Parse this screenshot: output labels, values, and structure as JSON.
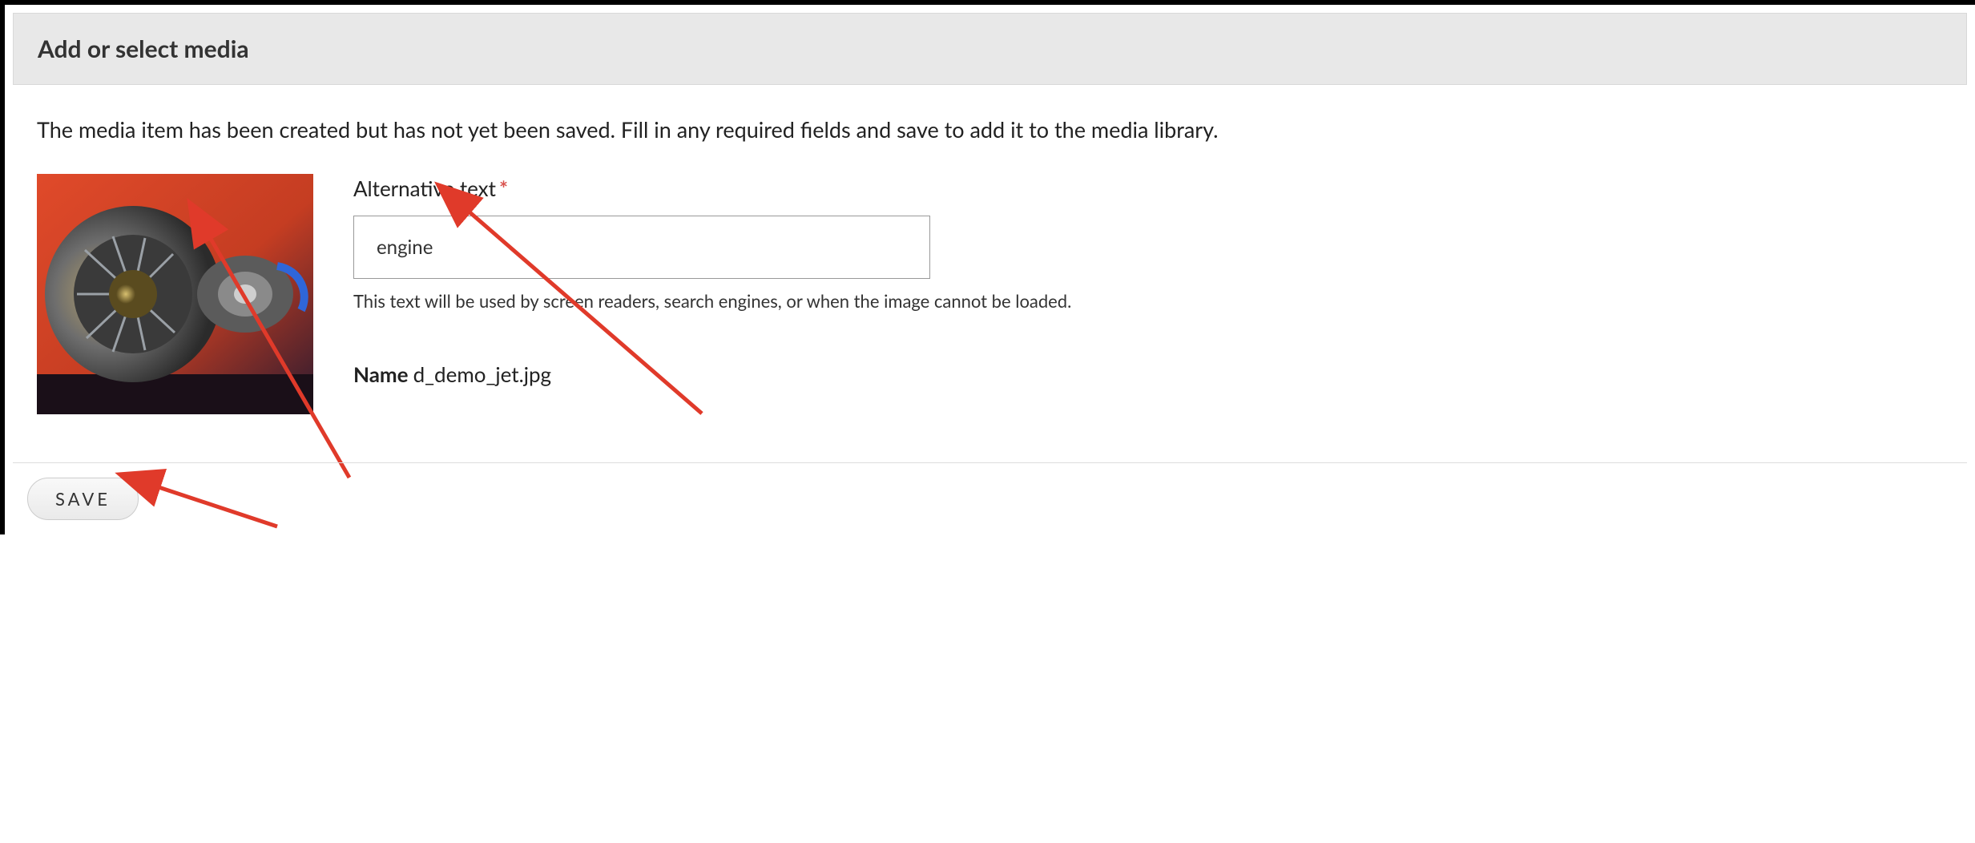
{
  "dialog": {
    "title": "Add or select media"
  },
  "instruction": "The media item has been created but has not yet been saved. Fill in any required fields and save to add it to the media library.",
  "alt_text": {
    "label": "Alternative text",
    "value": "engine",
    "help": "This text will be used by screen readers, search engines, or when the image cannot be loaded."
  },
  "name_field": {
    "label": "Name",
    "value": "d_demo_jet.jpg"
  },
  "actions": {
    "save_label": "SAVE"
  }
}
